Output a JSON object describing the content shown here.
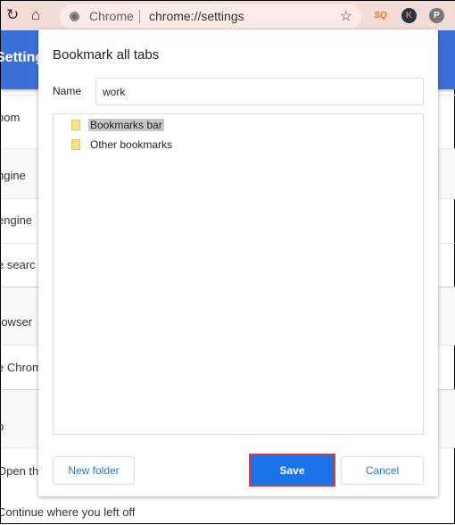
{
  "browser": {
    "site_label": "Chrome",
    "url": "chrome://settings",
    "icons": [
      "reload-icon",
      "home-icon",
      "chrome-icon",
      "star-icon",
      "extension-sq-icon",
      "extension-k-icon",
      "pinterest-icon"
    ],
    "ext_k": "K",
    "ext_sq": "SQ",
    "ext_p": "P"
  },
  "settings": {
    "header": "Settings",
    "rows": [
      "oom",
      "ngine",
      "engine",
      "e searc",
      "rowser",
      "e Chrom",
      "p",
      "Open th",
      "Continue where you left off"
    ]
  },
  "dialog": {
    "title": "Bookmark all tabs",
    "name_label": "Name",
    "name_value": "work",
    "folders": [
      {
        "label": "Bookmarks bar",
        "selected": true
      },
      {
        "label": "Other bookmarks",
        "selected": false
      }
    ],
    "new_folder": "New folder",
    "save": "Save",
    "cancel": "Cancel"
  },
  "colors": {
    "accent": "#1a73e8",
    "highlight_border": "#e53935",
    "header": "#3b6fd8"
  }
}
